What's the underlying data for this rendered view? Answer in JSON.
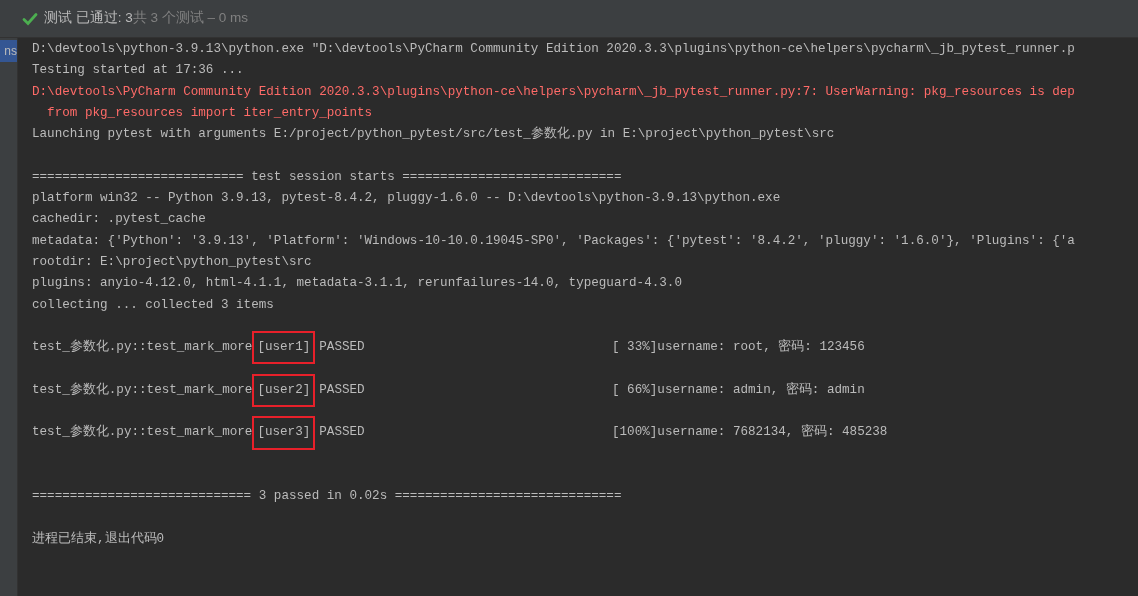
{
  "status_bar": {
    "passed": true,
    "summary": "测试 已通过: 3",
    "detail": "共 3 个测试 – 0 ms"
  },
  "side_tab": {
    "label": "ns",
    "selected": true
  },
  "console_lines": [
    {
      "kind": "stdout",
      "text": "D:\\devtools\\python-3.9.13\\python.exe \"D:\\devtools\\PyCharm Community Edition 2020.3.3\\plugins\\python-ce\\helpers\\pycharm\\_jb_pytest_runner.p"
    },
    {
      "kind": "stdout",
      "text": "Testing started at 17:36 ..."
    },
    {
      "kind": "stderr",
      "text": "D:\\devtools\\PyCharm Community Edition 2020.3.3\\plugins\\python-ce\\helpers\\pycharm\\_jb_pytest_runner.py:7: UserWarning: pkg_resources is dep"
    },
    {
      "kind": "stderr",
      "text": "  from pkg_resources import iter_entry_points"
    },
    {
      "kind": "stdout",
      "text": "Launching pytest with arguments E:/project/python_pytest/src/test_参数化.py in E:\\project\\python_pytest\\src"
    },
    {
      "kind": "blank"
    },
    {
      "kind": "stdout",
      "text": "============================ test session starts ============================="
    },
    {
      "kind": "stdout",
      "text": "platform win32 -- Python 3.9.13, pytest-8.4.2, pluggy-1.6.0 -- D:\\devtools\\python-3.9.13\\python.exe"
    },
    {
      "kind": "stdout",
      "text": "cachedir: .pytest_cache"
    },
    {
      "kind": "stdout",
      "text": "metadata: {'Python': '3.9.13', 'Platform': 'Windows-10-10.0.19045-SP0', 'Packages': {'pytest': '8.4.2', 'pluggy': '1.6.0'}, 'Plugins': {'a"
    },
    {
      "kind": "stdout",
      "text": "rootdir: E:\\project\\python_pytest\\src"
    },
    {
      "kind": "stdout",
      "text": "plugins: anyio-4.12.0, html-4.1.1, metadata-3.1.1, rerunfailures-14.0, typeguard-4.3.0"
    },
    {
      "kind": "stdout",
      "text": "collecting ... collected 3 items"
    },
    {
      "kind": "blank"
    },
    {
      "kind": "test",
      "name": "test_参数化.py::test_mark_more",
      "param": "[user1]",
      "highlighted": true,
      "status": "PASSED",
      "progress": "[ 33%]",
      "output": "username: root, 密码: 123456"
    },
    {
      "kind": "blank"
    },
    {
      "kind": "test",
      "name": "test_参数化.py::test_mark_more",
      "param": "[user2]",
      "highlighted": true,
      "status": "PASSED",
      "progress": "[ 66%]",
      "output": "username: admin, 密码: admin"
    },
    {
      "kind": "blank"
    },
    {
      "kind": "test",
      "name": "test_参数化.py::test_mark_more",
      "param": "[user3]",
      "highlighted": true,
      "status": "PASSED",
      "progress": "[100%]",
      "output": "username: 7682134, 密码: 485238"
    },
    {
      "kind": "blank"
    },
    {
      "kind": "blank"
    },
    {
      "kind": "stdout",
      "text": "============================= 3 passed in 0.02s =============================="
    },
    {
      "kind": "blank"
    },
    {
      "kind": "stdout",
      "text": "进程已结束,退出代码0"
    }
  ]
}
